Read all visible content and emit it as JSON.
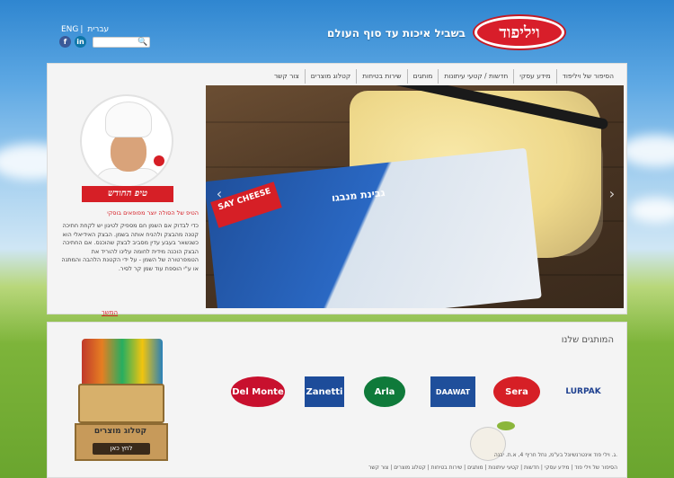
{
  "header": {
    "logo_text": "ויליפוד",
    "tagline": "בשביל איכות עד סוף העולם",
    "lang_en": "ENG",
    "lang_he": "עברית",
    "search_placeholder": ""
  },
  "nav": {
    "items": [
      {
        "label": "הסיפור של ויליפוד"
      },
      {
        "label": "מידע עסקי"
      },
      {
        "label": "חדשות / קטעי עיתונות"
      },
      {
        "label": "מותגים"
      },
      {
        "label": "שירות בטיחות"
      },
      {
        "label": "קטלוג מוצרים"
      },
      {
        "label": "צור קשר"
      }
    ]
  },
  "sidebar": {
    "tip_title": "טיפ החודש",
    "tip_subtitle": "הטיפ של הסולה יוצר מפופאים בוסקי",
    "tip_text": "כדי לבדוק אם השמן חם מספיק לטיגון יש לקחת חתיכה קטנה מהבצק ולהניח אותה בשמן. הבצק האידיאלי הוא כשנשאר בעבע עדין מסביב לבצק שהוכנס. אם החתיכה הבצק הוכנה מידית לחומה עלינו להוריד את הטמפרטורה של השמן - על ידי הקטנת הלהבה והמתנה או ע\"י הוספת עוד שמן קר לסיר.",
    "read_more": "המשך"
  },
  "hero": {
    "pack_sign": "SAY CHEESE",
    "pack_title": "גבינת מנבגו"
  },
  "products": {
    "title": "המותגים שלנו",
    "brands": [
      {
        "name": "Del Monte",
        "color": "#c8102e"
      },
      {
        "name": "Zanetti",
        "color": "#1d4c9a"
      },
      {
        "name": "Arla",
        "color": "#0f7a3a"
      },
      {
        "name": "DAAWAT",
        "color": "#1f4f9b"
      },
      {
        "name": "Sera",
        "color": "#d61f26"
      },
      {
        "name": "LURPAK",
        "color": "#1d3f8f"
      }
    ],
    "catalog_label": "קטלוג מוצרים",
    "catalog_button": "לחץ כאן"
  },
  "footer": {
    "address": "ג. וילי פוד אינטרנשיונל בע\"מ, נחל חריף 4, א.ת. יבנה.",
    "links": "הסיפור של וילי פוד | מידע עסקי | חדשות | קטעי עיתונות | מותגים | שירות בטיחות | קטלוג מוצרים | צור קשר"
  }
}
